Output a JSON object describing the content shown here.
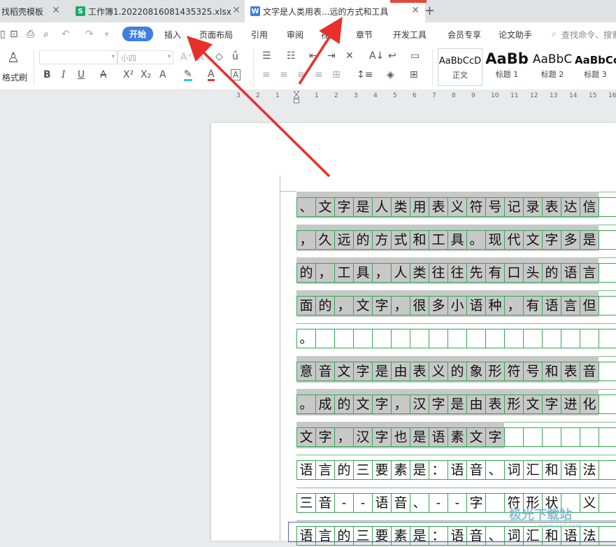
{
  "tabs": [
    {
      "label": "找稻壳模板",
      "icon": "",
      "active": false
    },
    {
      "label": "工作簿1.20220816081435325.xlsx",
      "icon": "S",
      "active": false
    },
    {
      "label": "文字是人类用表...远的方式和工具",
      "icon": "W",
      "active": true
    }
  ],
  "new_tab_label": "+",
  "menu": {
    "items": [
      "开始",
      "插入",
      "页面布局",
      "引用",
      "审阅",
      "视图",
      "章节",
      "开发工具",
      "会员专享",
      "论文助手"
    ],
    "active": "开始",
    "search_placeholder": "查找命令、搜索"
  },
  "ribbon": {
    "format_painter_label": "格式刷",
    "font_name": "",
    "font_size": "小四",
    "styles": [
      {
        "sample": "AaBbCcD",
        "name": "正文"
      },
      {
        "sample": "AaBb",
        "name": "标题 1"
      },
      {
        "sample": "AaBbC",
        "name": "标题 2"
      },
      {
        "sample": "AaBbCc",
        "name": "标题 3"
      }
    ]
  },
  "ruler_ticks": [
    "3",
    "2",
    "1",
    "1",
    "2",
    "3",
    "4",
    "5",
    "6",
    "7",
    "8",
    "9",
    "10",
    "11",
    "12",
    "13",
    "14",
    "15",
    "16"
  ],
  "document": {
    "rows": [
      "、文字是人类用表义符号记录表达信",
      "，久远的方式和工具。现代文字多是",
      "的，工具，人类往往先有口头的语言",
      "面的，文字，很多小语种，有语言但",
      "。",
      "意音文字是由表义的象形符号和表音",
      "。成的文字，汉字是由表形文字进化",
      "文字，汉字也是语素文字",
      "语言的三要素是：语音、词汇和语法",
      "三音--语音、--字 符形状 义 意",
      "语言的三要素是：语音、词汇和语法"
    ],
    "highlight_chars": [
      16,
      16,
      16,
      16,
      0,
      16,
      16,
      11,
      0,
      0,
      0
    ]
  },
  "watermark": {
    "text": "极光下载站",
    "sub": "www.xz7.com"
  },
  "colors": {
    "accent": "#3f7fe2",
    "arrow": "#e8302a",
    "grid": "#34a853",
    "selection": "#c8c8c8"
  }
}
